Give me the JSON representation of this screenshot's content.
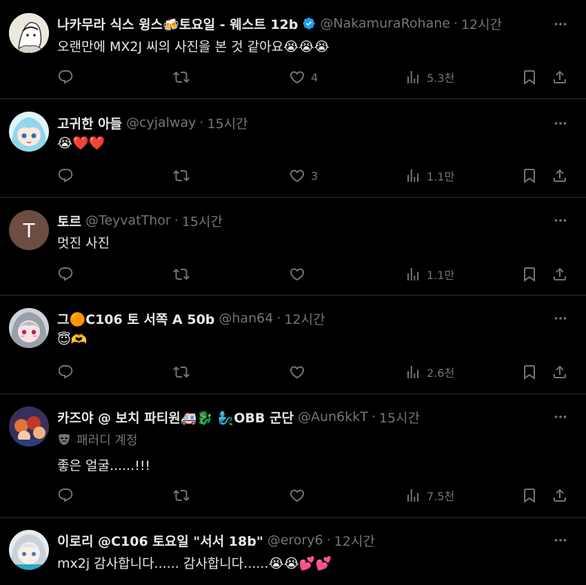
{
  "tweets": [
    {
      "name": "나카무라 식스 윙스🍻토요일 - 웨스트 12b",
      "handle": "@NakamuraRohane",
      "time": "12시간",
      "verified": true,
      "text": "오랜만에 MX2J 씨의 사진을 본 것 같아요😭😭😭",
      "likes": "4",
      "views": "5.3천"
    },
    {
      "name": "고귀한 아들",
      "handle": "@cyjalway",
      "time": "15시간",
      "text": "😭❤️❤️",
      "likes": "3",
      "views": "1.1만"
    },
    {
      "name": "토르",
      "handle": "@TeyvatThor",
      "time": "15시간",
      "avatar_letter": "T",
      "avatar_color": "#6d4c41",
      "text": "멋진 사진",
      "likes": "",
      "views": "1.1만"
    },
    {
      "name": "그🟠C106 토 서쪽 A 50b",
      "handle": "@han64",
      "time": "12시간",
      "text": "😇🫶",
      "likes": "",
      "views": "2.6천"
    },
    {
      "name": "카즈야 @ 보치 파티원🚑🐉 🧞‍♂️OBB 군단",
      "handle": "@Aun6kkT",
      "time": "15시간",
      "parody_label": "패러디 계정",
      "text": "좋은 얼굴......!!!",
      "likes": "",
      "views": "7.5천"
    },
    {
      "name": "이로리 @C106 토요일 \"서서 18b\"",
      "handle": "@erory6",
      "time": "12시간",
      "text": "mx2j 감사합니다...... 감사합니다......😭😭💕💕"
    }
  ],
  "separator": "·",
  "colors": {
    "background": "#000000",
    "text": "#e7e9ea",
    "muted": "#71767b",
    "verified": "#1d9bf0",
    "border": "#2f3336"
  },
  "icons": [
    "reply-icon",
    "retweet-icon",
    "like-icon",
    "views-icon",
    "bookmark-icon",
    "share-icon",
    "more-icon",
    "verified-icon"
  ]
}
